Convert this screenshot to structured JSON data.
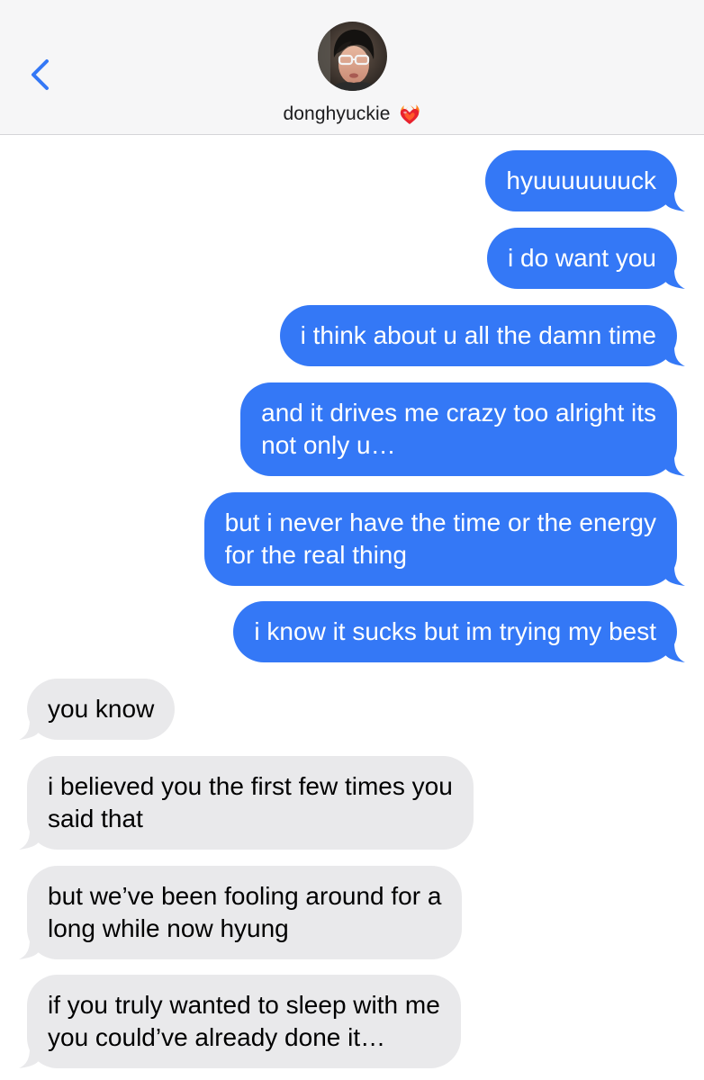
{
  "header": {
    "contact_name": "donghyuckie",
    "contact_emoji_icon": "heart-on-fire-icon",
    "back_icon": "chevron-left-icon",
    "avatar_icon": "contact-photo"
  },
  "colors": {
    "sent_bubble": "#3478f6",
    "received_bubble": "#e9e9eb",
    "accent": "#3478f6",
    "header_bg": "#f6f6f7"
  },
  "messages": [
    {
      "direction": "sent",
      "lines": [
        "hyuuuuuuuck"
      ]
    },
    {
      "direction": "sent",
      "lines": [
        "i do want you"
      ]
    },
    {
      "direction": "sent",
      "lines": [
        "i think about u all the damn time"
      ]
    },
    {
      "direction": "sent",
      "lines": [
        "and it drives me crazy too alright its",
        "not only u…"
      ]
    },
    {
      "direction": "sent",
      "lines": [
        "but i never have the time or the energy",
        "for the real thing"
      ]
    },
    {
      "direction": "sent",
      "lines": [
        "i know it sucks but im trying my best"
      ]
    },
    {
      "direction": "received",
      "lines": [
        "you know"
      ]
    },
    {
      "direction": "received",
      "lines": [
        "i believed you the first few times you",
        "said that"
      ]
    },
    {
      "direction": "received",
      "lines": [
        "but we’ve been fooling around for a",
        "long while now hyung"
      ]
    },
    {
      "direction": "received",
      "lines": [
        "if you truly wanted to sleep with me",
        "you could’ve already done it…"
      ]
    }
  ]
}
